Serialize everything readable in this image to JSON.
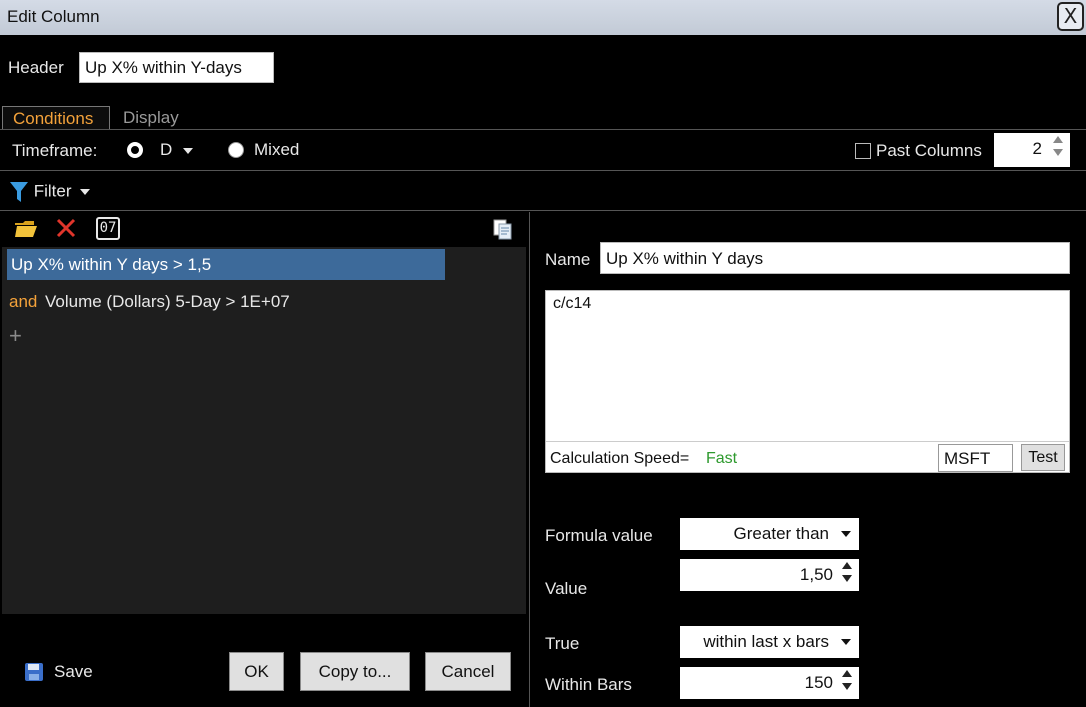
{
  "window": {
    "title": "Edit Column",
    "close_label": "X"
  },
  "header": {
    "label": "Header",
    "value": "Up X% within Y-days"
  },
  "tabs": [
    {
      "label": "Conditions"
    },
    {
      "label": "Display"
    }
  ],
  "timeframe": {
    "label": "Timeframe:",
    "selected": "D",
    "mixed_label": "Mixed"
  },
  "past_columns": {
    "label": "Past Columns",
    "value": "2"
  },
  "filter": {
    "label": "Filter"
  },
  "conditions": [
    {
      "connector": "",
      "text": "Up X% within Y days > 1,5"
    },
    {
      "connector": "and",
      "text": "Volume (Dollars) 5-Day > 1E+07"
    }
  ],
  "add_symbol": "+",
  "toolbar": {
    "counter_icon_text": "07"
  },
  "footer": {
    "save_label": "Save",
    "ok_label": "OK",
    "copy_label": "Copy to...",
    "cancel_label": "Cancel"
  },
  "editor": {
    "name_label": "Name",
    "name_value": "Up X% within Y days",
    "formula": "c/c14",
    "speed_label": "Calculation Speed=",
    "speed_value": "Fast",
    "symbol": "MSFT",
    "test_label": "Test"
  },
  "criteria": {
    "formula_value_label": "Formula value",
    "formula_value_option": "Greater than",
    "value_label": "Value",
    "value": "1,50",
    "true_label": "True",
    "true_option": "within last x bars",
    "within_bars_label": "Within Bars",
    "within_bars": "150"
  },
  "colors": {
    "accent_orange": "#f4a23a",
    "selection_blue": "#3d6a9a",
    "speed_green": "#2e9a2e"
  }
}
